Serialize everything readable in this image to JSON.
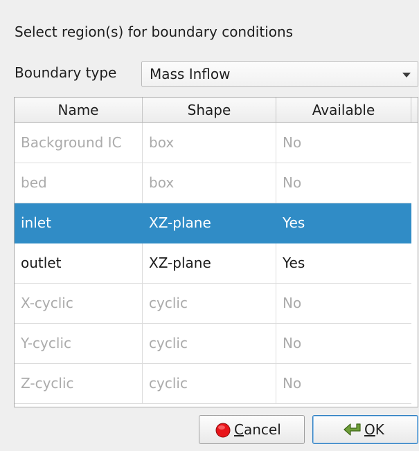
{
  "dialog": {
    "prompt": "Select region(s) for boundary conditions",
    "boundary_type_label": "Boundary type",
    "boundary_type_value": "Mass Inflow"
  },
  "table": {
    "columns": [
      "Name",
      "Shape",
      "Available"
    ],
    "rows": [
      {
        "name": "Background IC",
        "shape": "box",
        "available": "No",
        "state": "disabled"
      },
      {
        "name": "bed",
        "shape": "box",
        "available": "No",
        "state": "disabled"
      },
      {
        "name": "inlet",
        "shape": "XZ-plane",
        "available": "Yes",
        "state": "selected"
      },
      {
        "name": "outlet",
        "shape": "XZ-plane",
        "available": "Yes",
        "state": "enabled"
      },
      {
        "name": "X-cyclic",
        "shape": "cyclic",
        "available": "No",
        "state": "disabled"
      },
      {
        "name": "Y-cyclic",
        "shape": "cyclic",
        "available": "No",
        "state": "disabled"
      },
      {
        "name": "Z-cyclic",
        "shape": "cyclic",
        "available": "No",
        "state": "disabled"
      }
    ]
  },
  "buttons": {
    "cancel": {
      "mnemonic": "C",
      "rest": "ancel",
      "icon": "cancel-icon"
    },
    "ok": {
      "mnemonic": "O",
      "rest": "K",
      "icon": "ok-arrow-icon"
    }
  },
  "colors": {
    "selection": "#308cc6",
    "disabled_text": "#ababab",
    "cancel_icon_red": "#e8141a",
    "ok_icon_green": "#5e8f2d"
  }
}
